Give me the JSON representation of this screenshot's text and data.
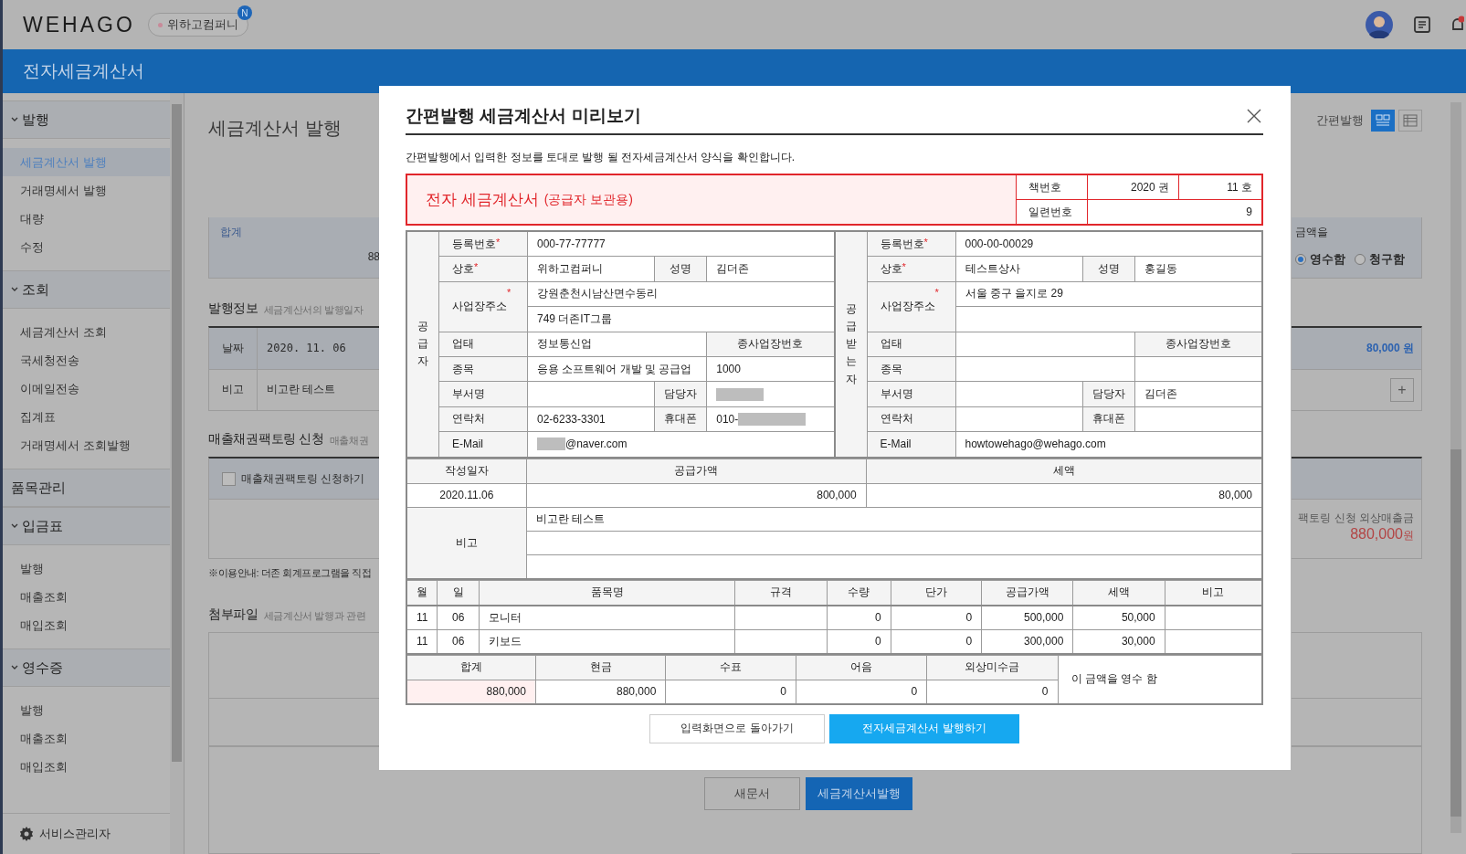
{
  "topbar": {
    "logo": "WEHAGO",
    "company": "위하고컴퍼니",
    "badge": "N"
  },
  "app_title": "전자세금계산서",
  "sidebar": {
    "sections": [
      {
        "label": "발행",
        "items": [
          {
            "label": "세금계산서 발행",
            "selected": true
          },
          {
            "label": "거래명세서 발행",
            "selected": false
          },
          {
            "label": "대량",
            "selected": false
          },
          {
            "label": "수정",
            "selected": false
          }
        ]
      },
      {
        "label": "조회",
        "items": [
          {
            "label": "세금계산서 조회",
            "selected": false
          },
          {
            "label": "국세청전송",
            "selected": false
          },
          {
            "label": "이메일전송",
            "selected": false
          },
          {
            "label": "집계표",
            "selected": false
          },
          {
            "label": "거래명세서 조회발행",
            "selected": false
          }
        ]
      },
      {
        "label": "품목관리"
      },
      {
        "label": "입금표",
        "items": [
          {
            "label": "발행",
            "selected": false
          },
          {
            "label": "매출조회",
            "selected": false
          },
          {
            "label": "매입조회",
            "selected": false
          }
        ]
      },
      {
        "label": "영수증",
        "items": [
          {
            "label": "발행",
            "selected": false
          },
          {
            "label": "매출조회",
            "selected": false
          },
          {
            "label": "매입조회",
            "selected": false
          }
        ]
      }
    ],
    "footer": "서비스관리자"
  },
  "page": {
    "title": "세금계산서 발행",
    "mode_label": "간편발행",
    "views": [
      {
        "kind": "form",
        "selected": true
      },
      {
        "kind": "grid",
        "selected": false
      }
    ],
    "total": {
      "label": "합계",
      "amount": "88"
    },
    "amount_prefix": "금액을",
    "receipt_options": [
      {
        "label": "영수함",
        "selected": true
      },
      {
        "label": "청구함",
        "selected": false
      }
    ],
    "issue_info": {
      "heading": "발행정보",
      "hint": "세금계산서의 발행일자",
      "rows": [
        {
          "label": "날짜",
          "value": "2020. 11. 06"
        },
        {
          "label": "비고",
          "value": "비고란 테스트"
        }
      ],
      "tax": "80,000 원",
      "add": "+"
    },
    "factoring": {
      "heading": "매출채권팩토링 신청",
      "hint": "매출채권",
      "checkbox": {
        "label": "매출채권팩토링 신청하기",
        "checked": false
      },
      "receivable_label": "팩토링 신청 외상매출금",
      "receivable": "880,000",
      "unit": "원"
    },
    "notice": "※이용안내: 더존 회계프로그램을 직접",
    "attachments": {
      "heading": "첨부파일",
      "hint": "세금계산서 발행과 관련"
    },
    "buttons": [
      {
        "label": "새문서",
        "kind": "secondary"
      },
      {
        "label": "세금계산서발행",
        "kind": "primary"
      }
    ]
  },
  "modal": {
    "title": "간편발행 세금계산서 미리보기",
    "description": "간편발행에서 입력한 정보를 토대로 발행 될 전자세금계산서 양식을 확인합니다.",
    "invoice": {
      "title": "전자 세금계산서",
      "subtitle": "(공급자 보관용)",
      "book_label": "책번호",
      "book_volume": "2020 권",
      "book_number": "11 호",
      "serial_label": "일련번호",
      "serial": "9",
      "parties": [
        {
          "side_label": "공급자",
          "reg": {
            "label": "등록번호",
            "mark": "*",
            "value": "000-77-77777"
          },
          "company": {
            "label": "상호",
            "mark": "*",
            "value": "위하고컴퍼니"
          },
          "ceo": {
            "label": "성명",
            "value": "김더존"
          },
          "address": {
            "label": "사업장주소",
            "mark": "*",
            "lines": [
              "강원춘천시남산면수동리",
              "749 더존IT그룹"
            ]
          },
          "business_type": {
            "label": "업태",
            "value": "정보통신업"
          },
          "branch_no": {
            "label": "종사업장번호",
            "value": "1000"
          },
          "business_item": {
            "label": "종목",
            "value": "응용 소프트웨어 개발 및 공급업"
          },
          "department": {
            "label": "부서명"
          },
          "manager": {
            "label": "담당자",
            "masked": true
          },
          "phone": {
            "label": "연락처",
            "value": "02-6233-3301"
          },
          "mobile": {
            "label": "휴대폰",
            "value": "010-",
            "masked": true
          },
          "email": {
            "label": "E-Mail",
            "value": "@naver.com",
            "masked": true
          }
        },
        {
          "side_label": "공급받는자",
          "reg": {
            "label": "등록번호",
            "mark": "*",
            "value": "000-00-00029"
          },
          "company": {
            "label": "상호",
            "mark": "*",
            "value": "테스트상사"
          },
          "ceo": {
            "label": "성명",
            "value": "홍길동"
          },
          "address": {
            "label": "사업장주소",
            "mark": "*",
            "lines": [
              "서울 중구 을지로 29"
            ]
          },
          "business_type": {
            "label": "업태"
          },
          "branch_no": {
            "label": "종사업장번호"
          },
          "business_item": {
            "label": "종목"
          },
          "department": {
            "label": "부서명"
          },
          "manager": {
            "label": "담당자",
            "value": "김더존"
          },
          "phone": {
            "label": "연락처"
          },
          "mobile": {
            "label": "휴대폰"
          },
          "email": {
            "label": "E-Mail",
            "value": "howtowehago@wehago.com"
          }
        }
      ],
      "summary": {
        "headers": [
          "작성일자",
          "공급가액",
          "세액"
        ],
        "values": [
          "2020.11.06",
          "800,000",
          "80,000"
        ]
      },
      "remarks": {
        "label": "비고",
        "lines": [
          "비고란 테스트"
        ]
      },
      "items": {
        "columns": [
          "월",
          "일",
          "품목명",
          "규격",
          "수량",
          "단가",
          "공급가액",
          "세액",
          "비고"
        ],
        "rows": [
          {
            "month": "11",
            "day": "06",
            "name": "모니터",
            "qty": "0",
            "unit_price": "0",
            "supply": "500,000",
            "tax": "50,000"
          },
          {
            "month": "11",
            "day": "06",
            "name": "키보드",
            "qty": "0",
            "unit_price": "0",
            "supply": "300,000",
            "tax": "30,000"
          }
        ]
      },
      "totals": {
        "headers": [
          "합계",
          "현금",
          "수표",
          "어음",
          "외상미수금"
        ],
        "values": [
          "880,000",
          "880,000",
          "0",
          "0",
          "0"
        ],
        "statement": "이 금액을 영수 함"
      }
    },
    "buttons": [
      {
        "label": "입력화면으로 돌아가기",
        "kind": "secondary"
      },
      {
        "label": "전자세금계산서 발행하기",
        "kind": "primary"
      }
    ]
  }
}
